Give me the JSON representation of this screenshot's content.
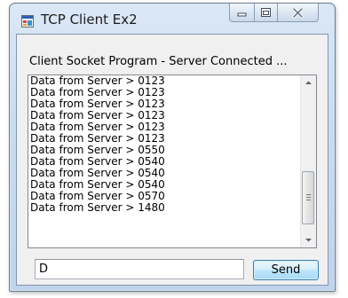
{
  "window": {
    "title": "TCP Client Ex2",
    "icon": "app-window-icon",
    "caption_buttons": [
      "minimize-icon",
      "maximize-icon",
      "close-icon"
    ]
  },
  "status": {
    "text": "Client Socket Program - Server Connected ..."
  },
  "messages": [
    "Data from Server > 0123",
    "Data from Server > 0123",
    "Data from Server > 0123",
    "Data from Server > 0123",
    "Data from Server > 0123",
    "Data from Server > 0123",
    "Data from Server > 0550",
    "Data from Server > 0540",
    "Data from Server > 0540",
    "Data from Server > 0540",
    "Data from Server > 0570",
    "Data from Server > 1480"
  ],
  "input": {
    "value": "D"
  },
  "send": {
    "label": "Send"
  },
  "colors": {
    "window_frame": "#c9dcf1",
    "client_bg": "#f0f0f0",
    "button_border": "#3c7fb1"
  }
}
